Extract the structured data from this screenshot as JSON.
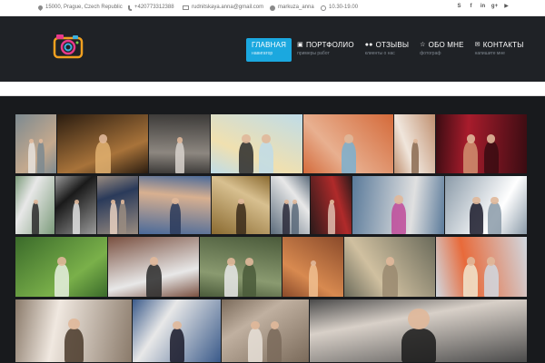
{
  "topbar": {
    "address": "15000, Prague, Czech Republic",
    "phone": "+420773312388",
    "email": "rudnitskaya.anna@gmail.com",
    "skype": "markuza_anna",
    "hours": "10.30-19.00",
    "social": [
      {
        "name": "skype-icon",
        "glyph": "S"
      },
      {
        "name": "facebook-icon",
        "glyph": "f"
      },
      {
        "name": "linkedin-icon",
        "glyph": "in"
      },
      {
        "name": "google-plus-icon",
        "glyph": "g+"
      },
      {
        "name": "youtube-icon",
        "glyph": "▶"
      }
    ]
  },
  "nav": {
    "items": [
      {
        "label": "ГЛАВНАЯ",
        "sub": "навигатор",
        "icon": "",
        "active": true
      },
      {
        "label": "ПОРТФОЛИО",
        "sub": "примеры работ",
        "icon": "camera-icon",
        "active": false
      },
      {
        "label": "ОТЗЫВЫ",
        "sub": "клиенты о нас",
        "icon": "users-icon",
        "active": false
      },
      {
        "label": "ОБО МНЕ",
        "sub": "фотограф",
        "icon": "star-icon",
        "active": false
      },
      {
        "label": "КОНТАКТЫ",
        "sub": "напишите мне",
        "icon": "envelope-icon",
        "active": false
      }
    ]
  },
  "colors": {
    "header_bg": "#1f2226",
    "accent": "#1ba8df",
    "gallery_bg": "#181a1d"
  },
  "gallery": {
    "photos": [
      {
        "name": "photo-couple-old-town",
        "colors": [
          "#7d8a90",
          "#c4a98e",
          "#e8e2dc"
        ]
      },
      {
        "name": "photo-bride-sparkler",
        "colors": [
          "#2a1c10",
          "#a8733a",
          "#e0b070"
        ]
      },
      {
        "name": "photo-couple-car",
        "colors": [
          "#3c3a38",
          "#8d8780",
          "#d8d2cc"
        ]
      },
      {
        "name": "photo-hot-air-balloon",
        "colors": [
          "#bfdce8",
          "#f0e0b0",
          "#2a2a2a"
        ]
      },
      {
        "name": "photo-prague-rooftops",
        "colors": [
          "#d46a3a",
          "#e8b090",
          "#7ab0d0"
        ]
      },
      {
        "name": "photo-bride-street",
        "colors": [
          "#c09070",
          "#f0e6dc",
          "#8a6a50"
        ]
      },
      {
        "name": "photo-red-flowers-couple",
        "colors": [
          "#3a0c12",
          "#a81c2c",
          "#d09070"
        ]
      },
      {
        "name": "photo-couple-park",
        "colors": [
          "#7d9c7c",
          "#e8e8e8",
          "#2a2a2a"
        ]
      },
      {
        "name": "photo-couple-umbrella",
        "colors": [
          "#9a9a9a",
          "#1a1a1a",
          "#e0e0e0"
        ]
      },
      {
        "name": "photo-groom-bride-portrait",
        "colors": [
          "#9a8c80",
          "#2a3a5a",
          "#e8d0c0"
        ]
      },
      {
        "name": "photo-couple-closeup-blue",
        "colors": [
          "#4a6a9a",
          "#d8b090",
          "#2a3a5a"
        ]
      },
      {
        "name": "photo-couple-golden",
        "colors": [
          "#8a6a30",
          "#d8c090",
          "#3a2a1a"
        ]
      },
      {
        "name": "photo-couple-bridge",
        "colors": [
          "#5a6a7a",
          "#e8e8e8",
          "#2a2a3a"
        ]
      },
      {
        "name": "photo-woman-reading-red",
        "colors": [
          "#2a1a1a",
          "#b02a2a",
          "#e0c0b0"
        ]
      },
      {
        "name": "photo-graffiti-wall",
        "colors": [
          "#5a7a9a",
          "#e0e0e0",
          "#c04a9a"
        ]
      },
      {
        "name": "photo-wedding-group",
        "colors": [
          "#8a9aa8",
          "#ffffff",
          "#1a1a2a"
        ]
      },
      {
        "name": "photo-green-garden",
        "colors": [
          "#3a6a2a",
          "#7ab04a",
          "#e8f0e0"
        ]
      },
      {
        "name": "photo-kiss-towers",
        "colors": [
          "#7a5040",
          "#e8e8e8",
          "#2a2a2a"
        ]
      },
      {
        "name": "photo-couple-forest",
        "colors": [
          "#4a5a3a",
          "#8a9a70",
          "#e8e8e8"
        ]
      },
      {
        "name": "photo-woman-golden-light",
        "colors": [
          "#8a4a2a",
          "#d88a50",
          "#f0c090"
        ]
      },
      {
        "name": "photo-couple-lying-grass",
        "colors": [
          "#6a6a5a",
          "#d0c0a0",
          "#9a8a70"
        ]
      },
      {
        "name": "photo-bouquet-table",
        "colors": [
          "#d0d8e0",
          "#e86a3a",
          "#f0e8d0"
        ]
      },
      {
        "name": "photo-bride-holding-flowers",
        "colors": [
          "#8a7a6a",
          "#f0e8e0",
          "#4a3a2a"
        ]
      },
      {
        "name": "photo-couple-hug-blue",
        "colors": [
          "#3a5a8a",
          "#e8e8e8",
          "#1a1a2a"
        ]
      },
      {
        "name": "photo-couple-river",
        "colors": [
          "#7a6a5a",
          "#c0b0a0",
          "#e8e0d8"
        ]
      },
      {
        "name": "photo-bride-charles-bridge",
        "colors": [
          "#4a4a4a",
          "#d8d0c8",
          "#1a1a1a"
        ]
      }
    ]
  }
}
